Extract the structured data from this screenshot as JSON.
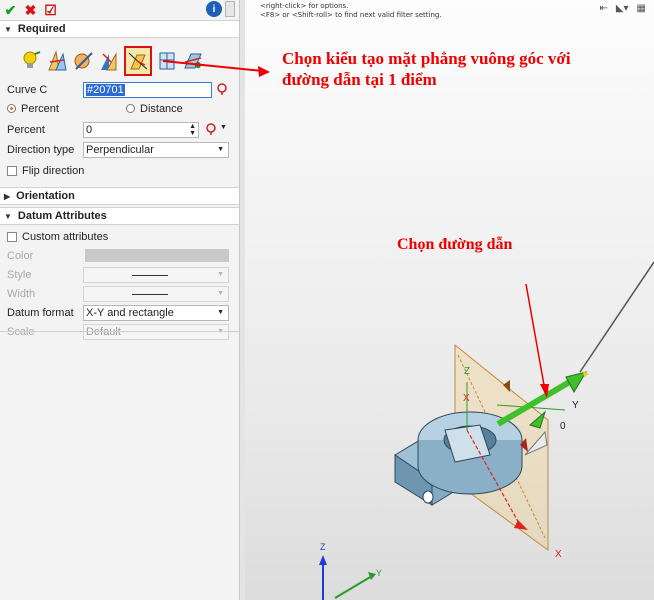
{
  "toolbar": {
    "ok_glyph": "✔",
    "cancel_glyph": "✖",
    "apply_glyph": "☑",
    "info_glyph": "i"
  },
  "required": {
    "title": "Required",
    "curve_label": "Curve C",
    "curve_value": "#20701",
    "percent_radio": "Percent",
    "distance_radio": "Distance",
    "percent_label": "Percent",
    "percent_value": "0",
    "direction_label": "Direction type",
    "direction_value": "Perpendicular",
    "flip_label": "Flip direction"
  },
  "orientation": {
    "title": "Orientation"
  },
  "datum": {
    "title": "Datum Attributes",
    "custom_label": "Custom attributes",
    "color_label": "Color",
    "style_label": "Style",
    "width_label": "Width",
    "format_label": "Datum format",
    "format_value": "X-Y and rectangle",
    "scale_label": "Scale",
    "scale_value": "Default"
  },
  "hint": {
    "line1": "<right-click> for options.",
    "line2": "<F8> or <Shift-roll> to find next valid filter setting."
  },
  "annotations": {
    "method_note_1": "Chọn kiểu tạo mặt phẳng vuông góc với",
    "method_note_2": "đường dẫn tại 1 điểm",
    "path_note": "Chọn đường dẫn"
  },
  "viewport_labels": {
    "z": "Z",
    "x": "X",
    "y": "Y",
    "zero": "0"
  },
  "colors": {
    "accent_red": "#e00000",
    "selected_frame": "#d11111",
    "plane_fill": "#f2c46b",
    "part_fill": "#8fb3c9",
    "arrow_green": "#3fbf2a"
  }
}
